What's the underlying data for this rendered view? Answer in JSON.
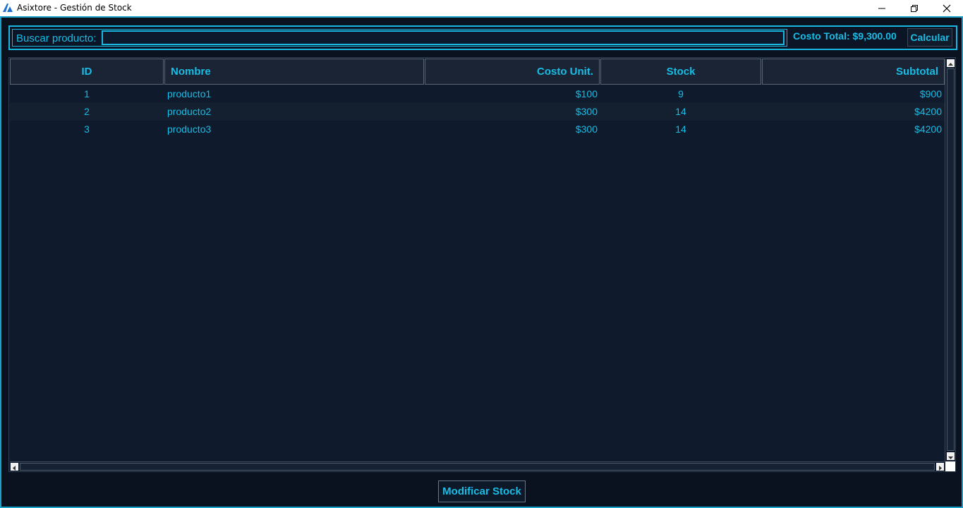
{
  "window": {
    "title": "Asixtore - Gestión de Stock",
    "minimize_glyph": "—",
    "maximize_glyph": "❐",
    "close_glyph": "✕"
  },
  "search": {
    "label": "Buscar producto:",
    "value": "",
    "placeholder": ""
  },
  "summary": {
    "cost_total": "Costo Total: $9,300.00",
    "calculate_label": "Calcular"
  },
  "table": {
    "columns": [
      "ID",
      "Nombre",
      "Costo Unit.",
      "Stock",
      "Subtotal"
    ],
    "rows": [
      [
        "1",
        "producto1",
        "$100",
        "9",
        "$900"
      ],
      [
        "2",
        "producto2",
        "$300",
        "14",
        "$4200"
      ],
      [
        "3",
        "producto3",
        "$300",
        "14",
        "$4200"
      ]
    ]
  },
  "actions": {
    "modify_stock_label": "Modificar Stock"
  },
  "colors": {
    "accent": "#18bde6",
    "background": "#0a1220",
    "table_background": "#0f1a2c",
    "header_background": "#1a2434"
  }
}
